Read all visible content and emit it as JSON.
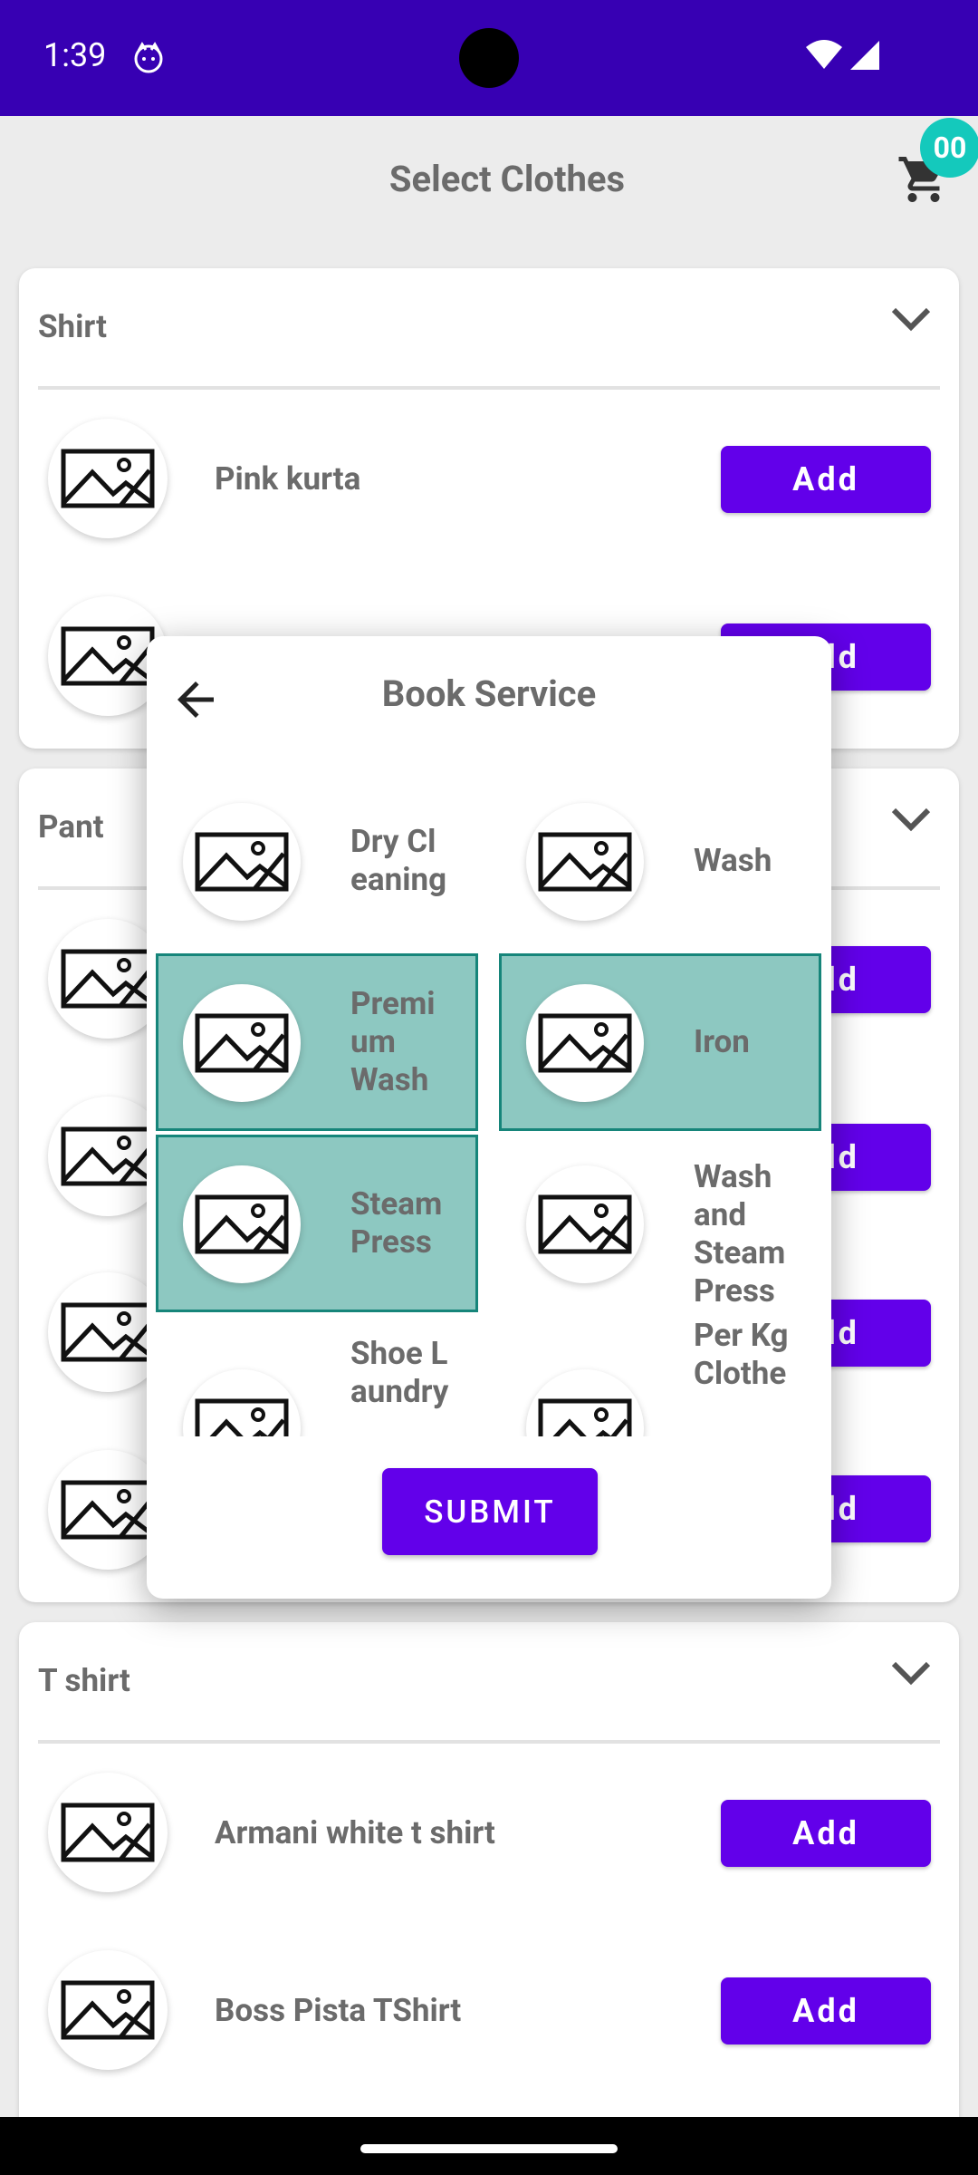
{
  "status_bar": {
    "time": "1:39"
  },
  "appbar": {
    "title": "Select Clothes",
    "cart_count": "00"
  },
  "categories": [
    {
      "title": "Shirt",
      "items": [
        {
          "name": "Pink kurta",
          "add_label": "Add"
        },
        {
          "name": "",
          "add_label": "Add"
        }
      ]
    },
    {
      "title": "Pant",
      "items": [
        {
          "add_label": "Add"
        },
        {
          "add_label": "Add"
        },
        {
          "add_label": "Add"
        },
        {
          "add_label": "Add"
        }
      ]
    },
    {
      "title": "T shirt",
      "items": [
        {
          "name": "Armani white t shirt",
          "add_label": "Add"
        },
        {
          "name": "Boss Pista TShirt",
          "add_label": "Add"
        }
      ]
    }
  ],
  "dialog": {
    "title": "Book Service",
    "services": [
      {
        "label": "Dry Cl eaning",
        "selected": false
      },
      {
        "label": "Wash",
        "selected": false
      },
      {
        "label": "Premi um Wash",
        "selected": true
      },
      {
        "label": "Iron",
        "selected": true
      },
      {
        "label": "Steam Press",
        "selected": true
      },
      {
        "label": "Wash and Steam Press",
        "selected": false
      },
      {
        "label": "Shoe L aundry",
        "selected": false
      },
      {
        "label": "Per Kg Clothe",
        "selected": false
      }
    ],
    "submit_label": "SUBMIT"
  },
  "colors": {
    "status_bar": "#3700b3",
    "accent": "#6200ea",
    "badge": "#14c9bc",
    "selected_fill": "#8dc8c1",
    "selected_border": "#16857a"
  }
}
